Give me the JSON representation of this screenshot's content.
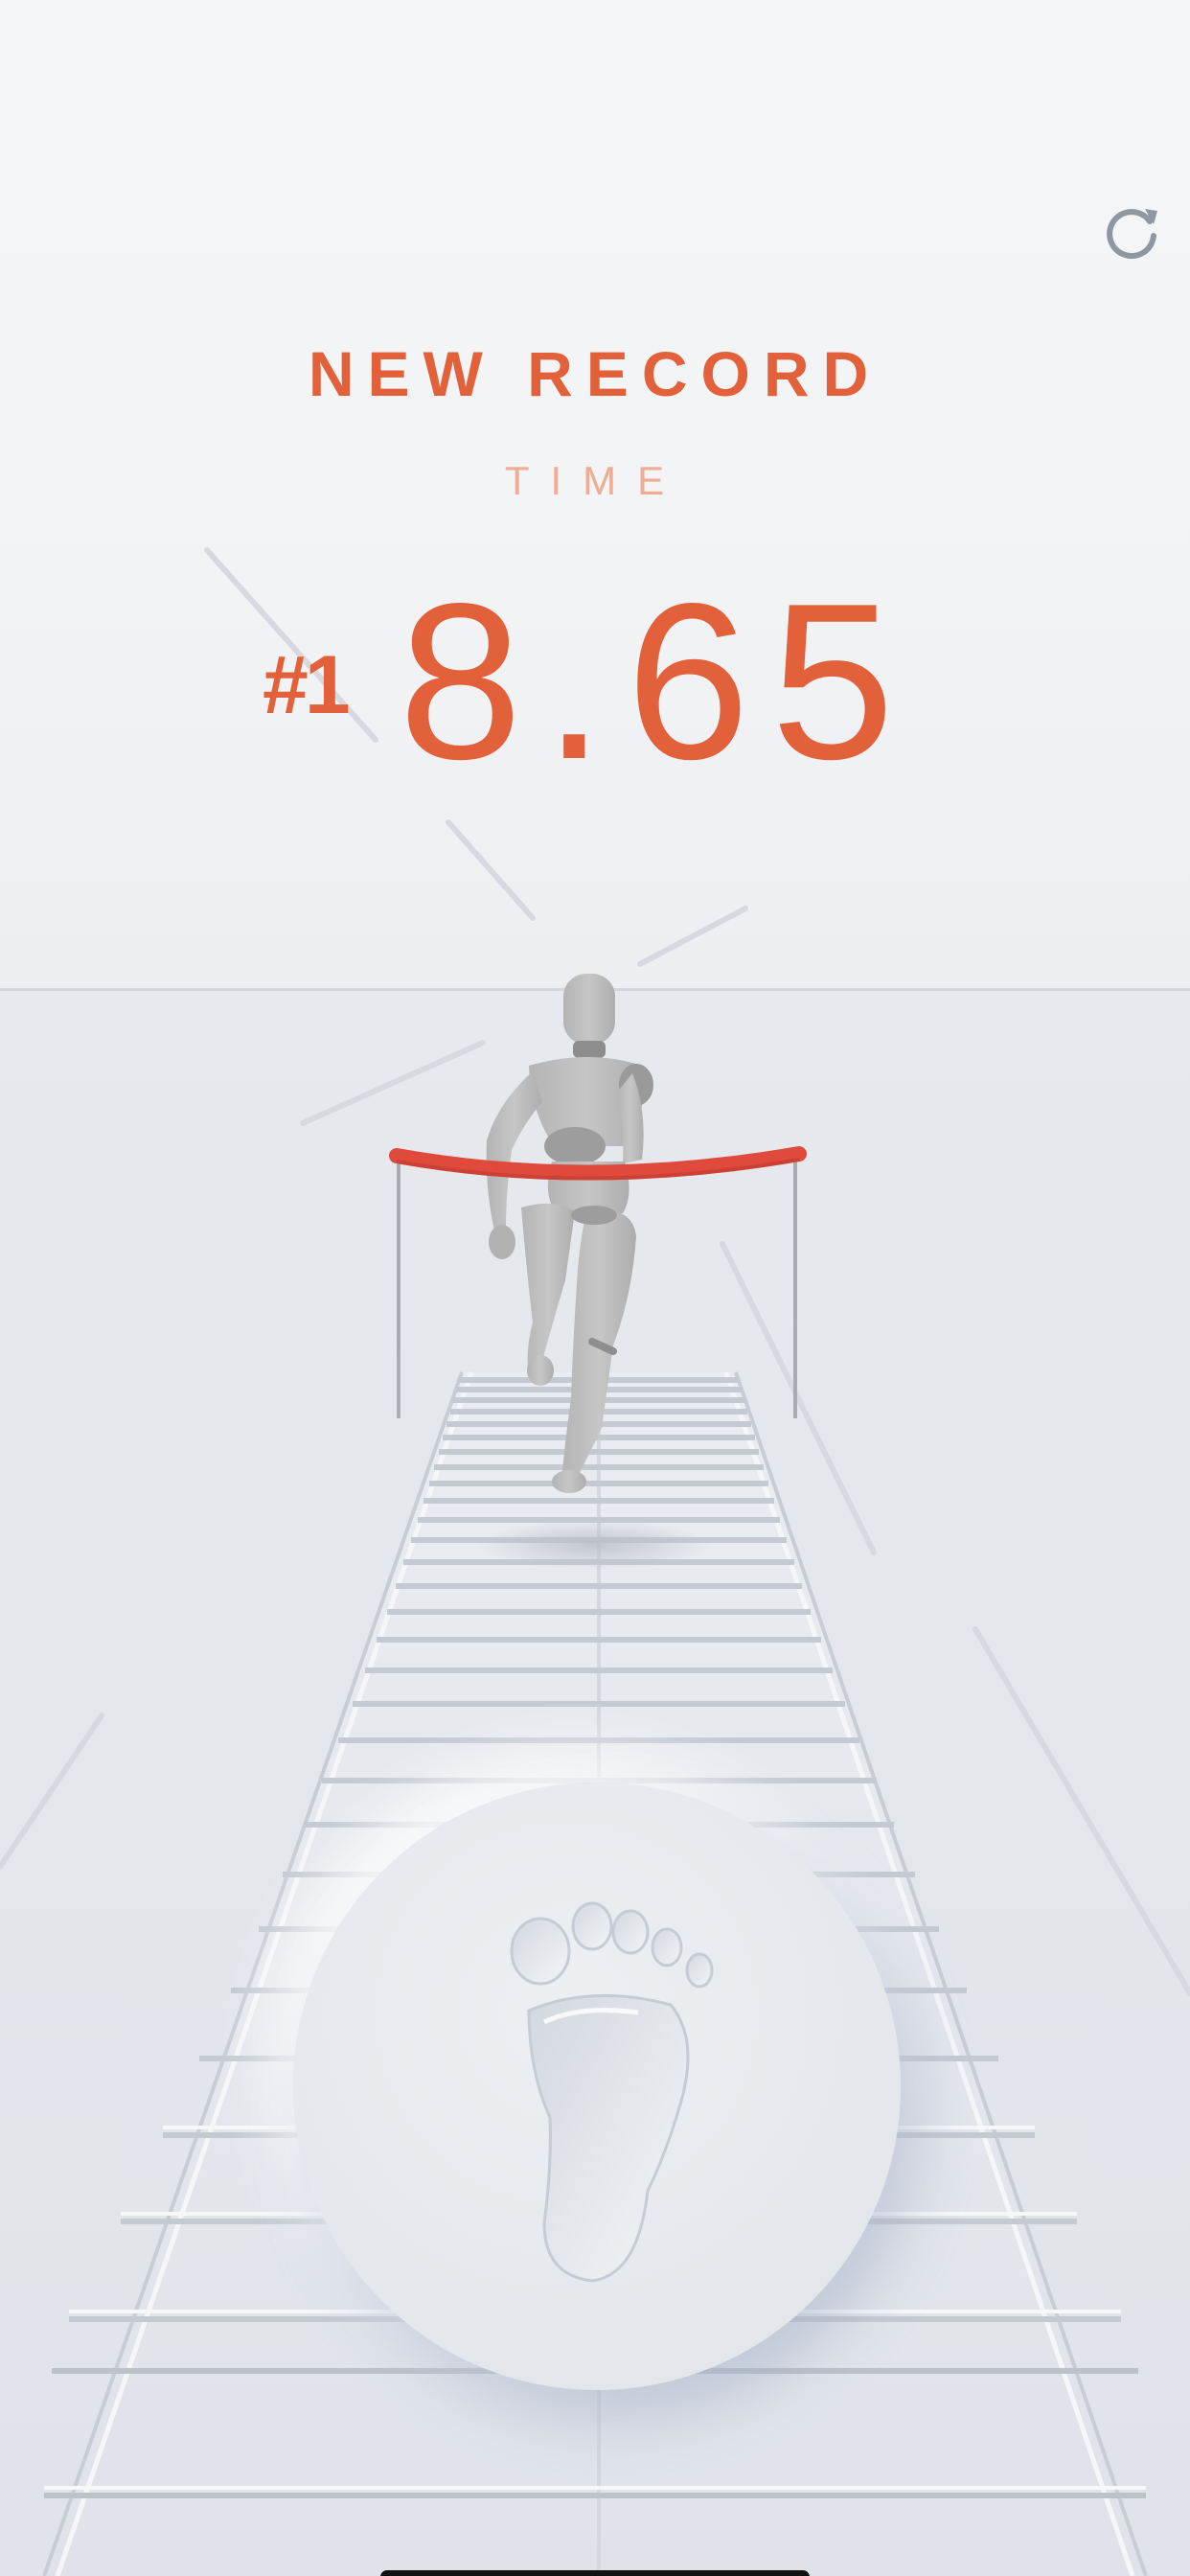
{
  "result": {
    "headline": "NEW RECORD",
    "metric_label": "TIME",
    "rank": "#1",
    "time": "8.65"
  },
  "controls": {
    "restart_icon": "refresh-icon",
    "tap_icon": "footprint-icon"
  },
  "colors": {
    "accent": "#e2603a",
    "accent_light": "#efab93",
    "finish_tape": "#e04a3c",
    "background": "#eef0f3"
  }
}
